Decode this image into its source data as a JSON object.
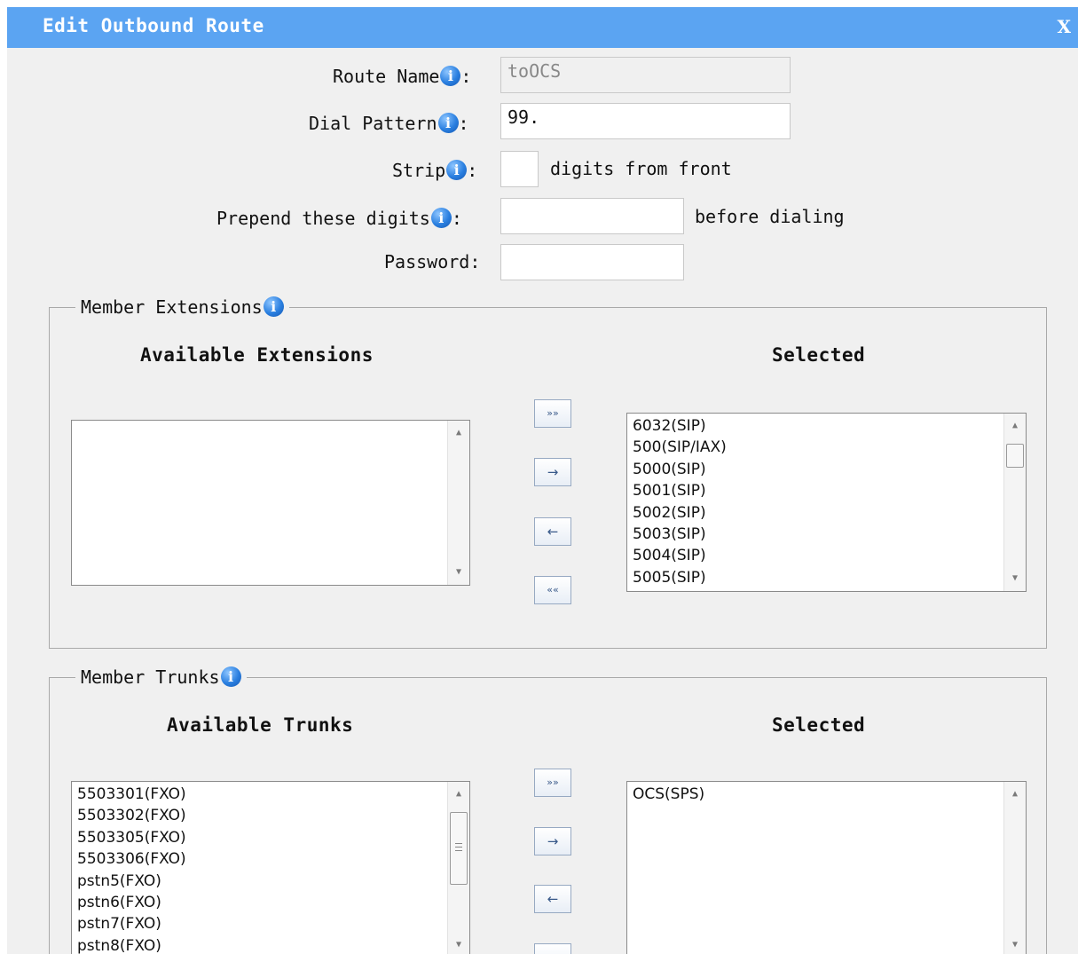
{
  "dialog": {
    "title": "Edit Outbound Route",
    "close_label": "X"
  },
  "form": {
    "route_name": {
      "label": "Route Name",
      "value": "toOCS"
    },
    "dial_pattern": {
      "label": "Dial Pattern",
      "value": "99."
    },
    "strip": {
      "label": "Strip",
      "value": "",
      "suffix": "digits from front"
    },
    "prepend": {
      "label": "Prepend these digits",
      "value": "",
      "suffix": "before dialing"
    },
    "password": {
      "label": "Password",
      "value": ""
    },
    "colon": ":"
  },
  "extensions": {
    "legend": "Member Extensions",
    "available_title": "Available Extensions",
    "selected_title": "Selected",
    "available": [],
    "selected": [
      "6032(SIP)",
      "500(SIP/IAX)",
      "5000(SIP)",
      "5001(SIP)",
      "5002(SIP)",
      "5003(SIP)",
      "5004(SIP)",
      "5005(SIP)"
    ]
  },
  "trunks": {
    "legend": "Member Trunks",
    "available_title": "Available Trunks",
    "selected_title": "Selected",
    "available": [
      "5503301(FXO)",
      "5503302(FXO)",
      "5503305(FXO)",
      "5503306(FXO)",
      "pstn5(FXO)",
      "pstn6(FXO)",
      "pstn7(FXO)",
      "pstn8(FXO)"
    ],
    "selected": [
      "OCS(SPS)"
    ]
  },
  "buttons": {
    "add_all": "»»",
    "add": "→",
    "remove": "←",
    "remove_all": "««"
  },
  "icons": {
    "info": "i",
    "scroll_up": "▲",
    "scroll_down": "▼"
  }
}
